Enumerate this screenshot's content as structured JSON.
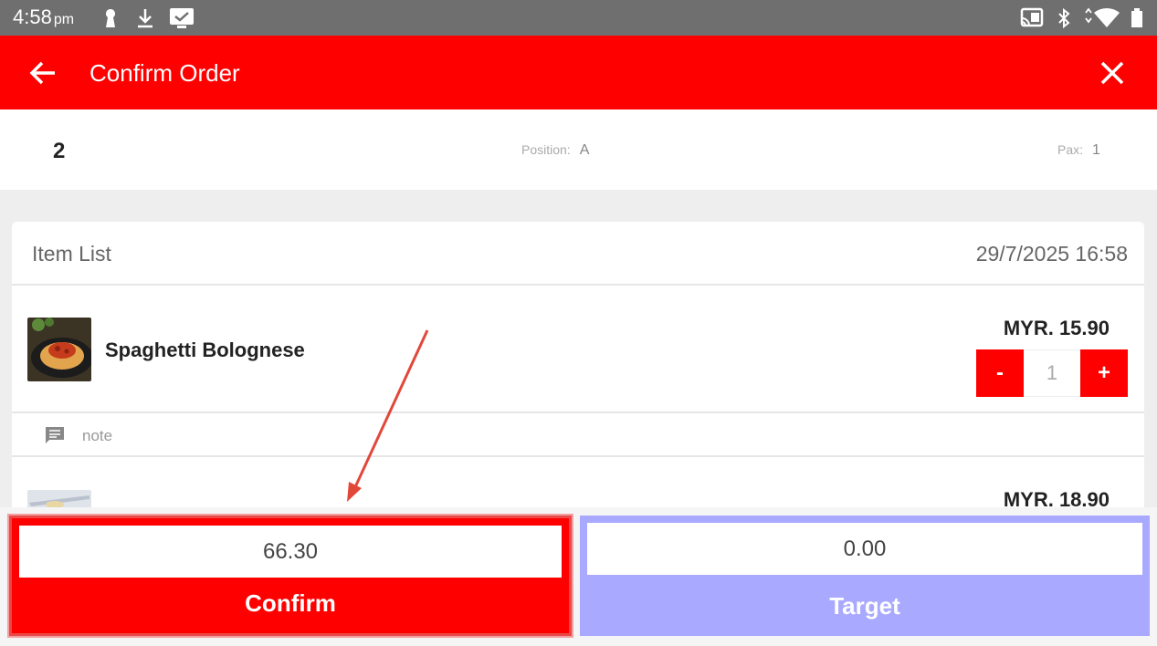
{
  "status_bar": {
    "time": "4:58",
    "ampm": "pm"
  },
  "appbar": {
    "title": "Confirm Order"
  },
  "order_info": {
    "table": "2",
    "position_label": "Position:",
    "position_value": "A",
    "pax_label": "Pax:",
    "pax_value": "1"
  },
  "item_list": {
    "title": "Item List",
    "date": "29/7/2025 16:58",
    "items": [
      {
        "name": "Spaghetti Bolognese",
        "price": "MYR. 15.90",
        "qty": "1",
        "minus": "-",
        "plus": "+",
        "note_placeholder": "note"
      },
      {
        "name": "",
        "price": "MYR. 18.90"
      }
    ]
  },
  "footer": {
    "confirm": {
      "amount": "66.30",
      "label": "Confirm"
    },
    "target": {
      "amount": "0.00",
      "label": "Target"
    }
  },
  "colors": {
    "primary": "#ff0000",
    "target": "#a9a9ff",
    "status_bar": "#6f6f6f"
  }
}
